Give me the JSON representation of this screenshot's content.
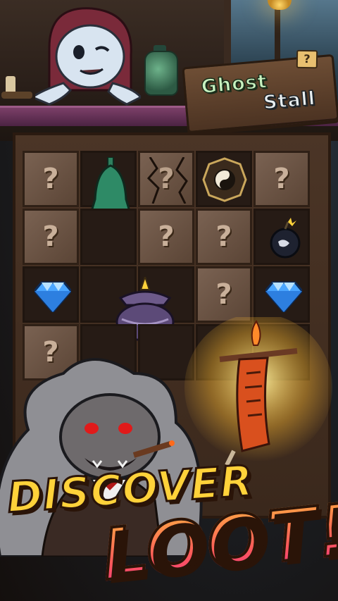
{
  "sign": {
    "line1": "Ghost",
    "line2": "Stall",
    "tag": "?"
  },
  "slogan": {
    "line1": "DISCOVER",
    "line2": "LOOT!"
  },
  "grid": {
    "hidden_symbol": "?",
    "cells": [
      {
        "state": "hidden"
      },
      {
        "state": "item",
        "item": "jade-bell"
      },
      {
        "state": "cracked"
      },
      {
        "state": "item",
        "item": "bagua-mirror"
      },
      {
        "state": "hidden"
      },
      {
        "state": "hidden"
      },
      {
        "state": "empty"
      },
      {
        "state": "hidden"
      },
      {
        "state": "hidden"
      },
      {
        "state": "item",
        "item": "bomb"
      },
      {
        "state": "item",
        "item": "diamond"
      },
      {
        "state": "empty"
      },
      {
        "state": "item",
        "item": "incense-burner"
      },
      {
        "state": "hidden"
      },
      {
        "state": "item",
        "item": "diamond"
      },
      {
        "state": "hidden"
      },
      {
        "state": "empty"
      },
      {
        "state": "empty"
      },
      {
        "state": "empty"
      },
      {
        "state": "empty"
      }
    ]
  },
  "colors": {
    "slogan_top": "#ffd23a",
    "slogan_bottom": "#ff7a3a",
    "sign_green": "#c8f2c0"
  }
}
